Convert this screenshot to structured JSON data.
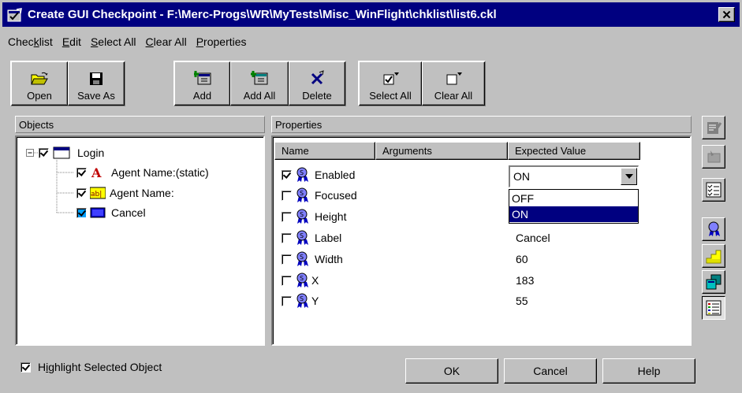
{
  "window": {
    "title": "Create GUI Checkpoint - F:\\Merc-Progs\\WR\\MyTests\\Misc_WinFlight\\chklist\\list6.ckl",
    "close": "✕"
  },
  "menu": [
    {
      "pre": "Chec",
      "key": "k",
      "post": "list"
    },
    {
      "pre": "",
      "key": "E",
      "post": "dit"
    },
    {
      "pre": "",
      "key": "S",
      "post": "elect All"
    },
    {
      "pre": "",
      "key": "C",
      "post": "lear All"
    },
    {
      "pre": "",
      "key": "P",
      "post": "roperties"
    }
  ],
  "toolbar": {
    "open": "Open",
    "save_as": "Save As",
    "add": "Add",
    "add_all": "Add All",
    "delete": "Delete",
    "select_all": "Select All",
    "clear_all": "Clear All"
  },
  "objects": {
    "header": "Objects",
    "root": {
      "label": "Login",
      "checked": true
    },
    "children": [
      {
        "label": "Agent Name:(static)",
        "checked": true,
        "icon": "static-text-icon"
      },
      {
        "label": "Agent Name:",
        "checked": true,
        "icon": "edit-field-icon"
      },
      {
        "label": "Cancel",
        "checked": true,
        "icon": "push-button-icon"
      }
    ]
  },
  "properties": {
    "header": "Properties",
    "columns": {
      "name": "Name",
      "arguments": "Arguments",
      "expected": "Expected Value"
    },
    "rows": [
      {
        "name": "Enabled",
        "checked": true,
        "value": "ON"
      },
      {
        "name": "Focused",
        "checked": false,
        "value": ""
      },
      {
        "name": "Height",
        "checked": false,
        "value": ""
      },
      {
        "name": "Label",
        "checked": false,
        "value": "Cancel"
      },
      {
        "name": "Width",
        "checked": false,
        "value": "60"
      },
      {
        "name": "X",
        "checked": false,
        "value": "183"
      },
      {
        "name": "Y",
        "checked": false,
        "value": "55"
      }
    ],
    "dropdown": {
      "selected": "ON",
      "options": [
        "OFF",
        "ON"
      ],
      "highlighted": "ON"
    }
  },
  "highlight": {
    "pre": "H",
    "key": "i",
    "post": "ghlight Selected Object",
    "checked": true
  },
  "buttons": {
    "ok": "OK",
    "cancel": "Cancel",
    "help": "Help"
  },
  "colors": {
    "face": "#c0c0c0",
    "title": "#000080",
    "selection": "#000080"
  }
}
